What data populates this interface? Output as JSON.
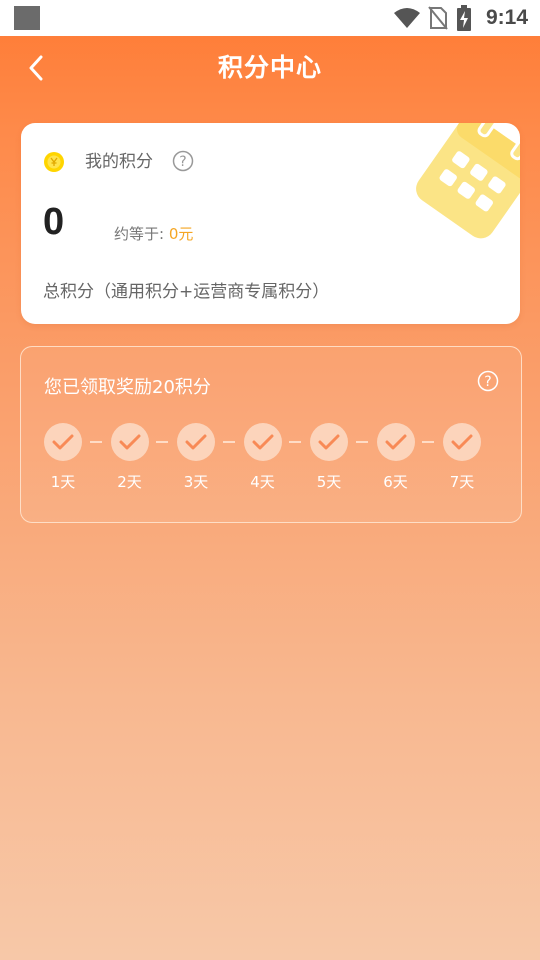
{
  "status_bar": {
    "time": "9:14",
    "icons": [
      "app-icon",
      "wifi-icon",
      "no-sim-icon",
      "battery-charging-icon"
    ]
  },
  "header": {
    "title": "积分中心",
    "back_icon": "chevron-left-icon"
  },
  "points_card": {
    "title": "我的积分",
    "value": "0",
    "approx_label": "约等于: ",
    "approx_value": "0元",
    "description": "总积分（通用积分+运营商专属积分）",
    "coin_icon": "coin-icon",
    "help_icon": "help-icon",
    "decoration_icon": "calendar-icon"
  },
  "signin": {
    "title": "您已领取奖励20积分",
    "help_icon": "help-icon",
    "days": [
      {
        "label": "1天",
        "checked": true
      },
      {
        "label": "2天",
        "checked": true
      },
      {
        "label": "3天",
        "checked": true
      },
      {
        "label": "4天",
        "checked": true
      },
      {
        "label": "5天",
        "checked": true
      },
      {
        "label": "6天",
        "checked": true
      },
      {
        "label": "7天",
        "checked": true
      }
    ]
  },
  "colors": {
    "accent_orange": "#ff7a33",
    "coin_yellow": "#ffd500",
    "approx_value": "#f5a623",
    "check_circle": "#fcd4bb",
    "check_mark": "#f88a56"
  }
}
